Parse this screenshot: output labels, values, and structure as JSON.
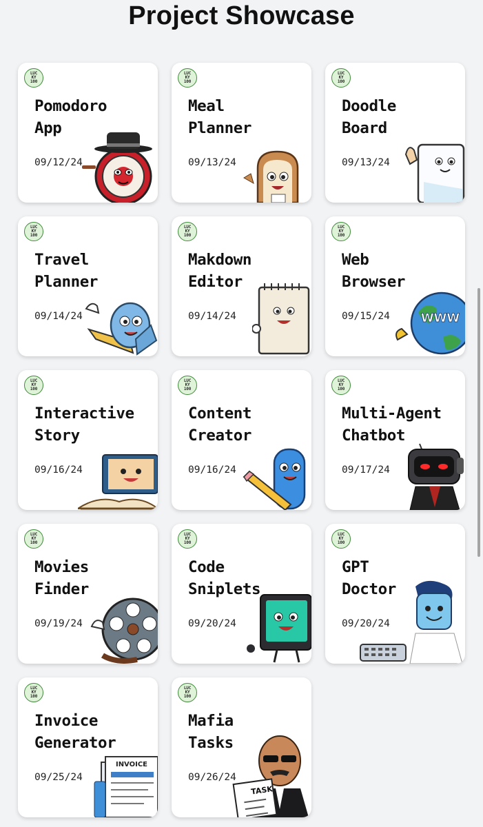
{
  "page": {
    "title": "Project Showcase"
  },
  "badge": {
    "line1": "LUC",
    "line2": "KY",
    "line3": "100"
  },
  "projects": [
    {
      "title": "Pomodoro\nApp",
      "date": "09/12/24",
      "mascot_icon": "clock-mascot-icon"
    },
    {
      "title": "Meal\nPlanner",
      "date": "09/13/24",
      "mascot_icon": "toast-mascot-icon"
    },
    {
      "title": "Doodle\nBoard",
      "date": "09/13/24",
      "mascot_icon": "whiteboard-mascot-icon"
    },
    {
      "title": "Travel\nPlanner",
      "date": "09/14/24",
      "mascot_icon": "airplane-mascot-icon"
    },
    {
      "title": "Makdown\nEditor",
      "date": "09/14/24",
      "mascot_icon": "notepad-mascot-icon"
    },
    {
      "title": "Web\nBrowser",
      "date": "09/15/24",
      "mascot_icon": "globe-mascot-icon",
      "mascot_text": "WWW"
    },
    {
      "title": "Interactive\nStory",
      "date": "09/16/24",
      "mascot_icon": "book-mascot-icon"
    },
    {
      "title": "Content\nCreator",
      "date": "09/16/24",
      "mascot_icon": "pencil-mascot-icon"
    },
    {
      "title": "Multi-Agent\nChatbot",
      "date": "09/17/24",
      "mascot_icon": "robot-mascot-icon"
    },
    {
      "title": "Movies\nFinder",
      "date": "09/19/24",
      "mascot_icon": "film-reel-mascot-icon"
    },
    {
      "title": "Code\nSniplets",
      "date": "09/20/24",
      "mascot_icon": "computer-mascot-icon"
    },
    {
      "title": "GPT\nDoctor",
      "date": "09/20/24",
      "mascot_icon": "doctor-mascot-icon"
    },
    {
      "title": "Invoice\nGenerator",
      "date": "09/25/24",
      "mascot_icon": "invoice-mascot-icon",
      "mascot_text": "INVOICE"
    },
    {
      "title": "Mafia\nTasks",
      "date": "09/26/24",
      "mascot_icon": "mafia-boss-mascot-icon",
      "mascot_text": "TASK"
    }
  ],
  "colors": {
    "background": "#f2f3f5",
    "card": "#ffffff",
    "badge_fill": "#dff3d8",
    "badge_border": "#3f8a3a"
  }
}
